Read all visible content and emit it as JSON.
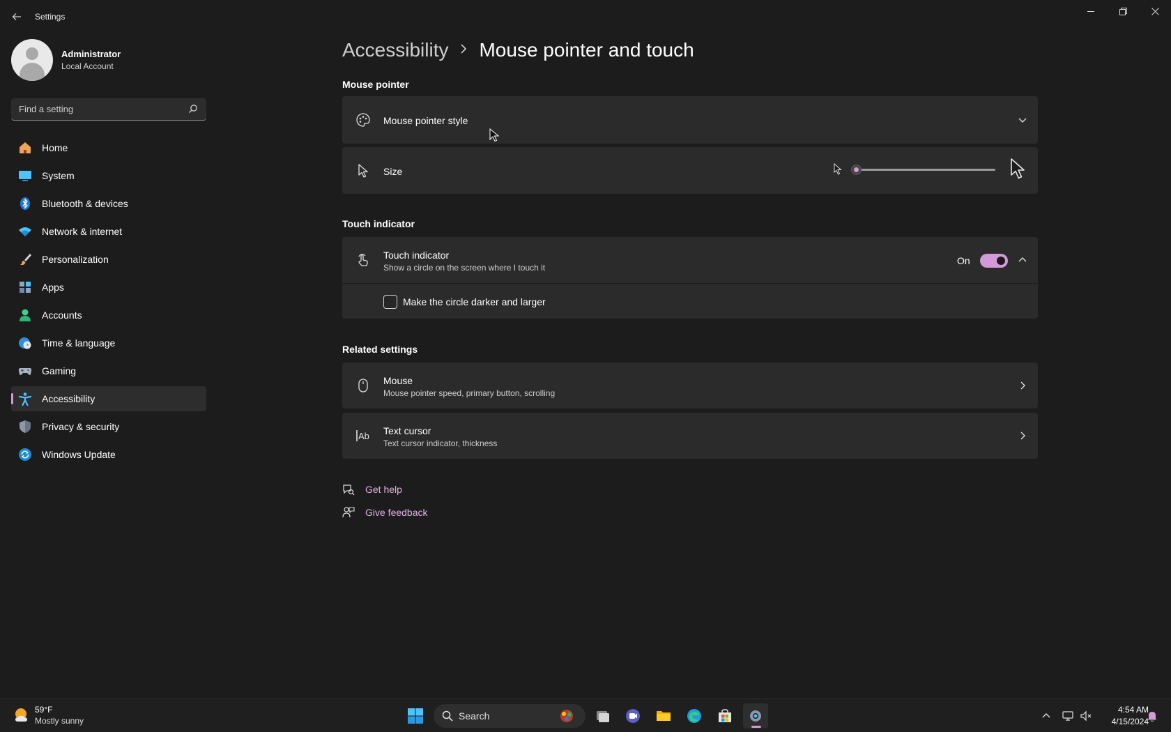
{
  "window": {
    "title": "Settings"
  },
  "profile": {
    "name": "Administrator",
    "account_type": "Local Account"
  },
  "search": {
    "placeholder": "Find a setting"
  },
  "sidebar": {
    "items": [
      {
        "label": "Home",
        "icon": "home-icon"
      },
      {
        "label": "System",
        "icon": "system-icon"
      },
      {
        "label": "Bluetooth & devices",
        "icon": "bluetooth-icon"
      },
      {
        "label": "Network & internet",
        "icon": "wifi-icon"
      },
      {
        "label": "Personalization",
        "icon": "brush-icon"
      },
      {
        "label": "Apps",
        "icon": "apps-icon"
      },
      {
        "label": "Accounts",
        "icon": "accounts-icon"
      },
      {
        "label": "Time & language",
        "icon": "globe-clock-icon"
      },
      {
        "label": "Gaming",
        "icon": "gamepad-icon"
      },
      {
        "label": "Accessibility",
        "icon": "accessibility-icon",
        "active": true
      },
      {
        "label": "Privacy & security",
        "icon": "shield-icon"
      },
      {
        "label": "Windows Update",
        "icon": "update-icon"
      }
    ],
    "accent_color": "#d29ad6"
  },
  "breadcrumb": {
    "parent": "Accessibility",
    "current": "Mouse pointer and touch"
  },
  "mouse_pointer": {
    "section_title": "Mouse pointer",
    "style": {
      "label": "Mouse pointer style",
      "icon": "palette-icon"
    },
    "size": {
      "label": "Size",
      "icon": "pointer-icon",
      "value_fraction": 0.0
    }
  },
  "touch_indicator": {
    "section_title": "Touch indicator",
    "title": "Touch indicator",
    "description": "Show a circle on the screen where I touch it",
    "toggle_state": "On",
    "checkbox_label": "Make the circle darker and larger",
    "checkbox_checked": false
  },
  "related_settings": {
    "section_title": "Related settings",
    "items": [
      {
        "title": "Mouse",
        "description": "Mouse pointer speed, primary button, scrolling",
        "icon": "mouse-icon"
      },
      {
        "title": "Text cursor",
        "description": "Text cursor indicator, thickness",
        "icon": "text-cursor-icon"
      }
    ]
  },
  "help": {
    "get_help": "Get help",
    "give_feedback": "Give feedback"
  },
  "taskbar": {
    "weather_temp": "59°F",
    "weather_desc": "Mostly sunny",
    "search_label": "Search",
    "time": "4:54 AM",
    "date": "4/15/2024"
  }
}
